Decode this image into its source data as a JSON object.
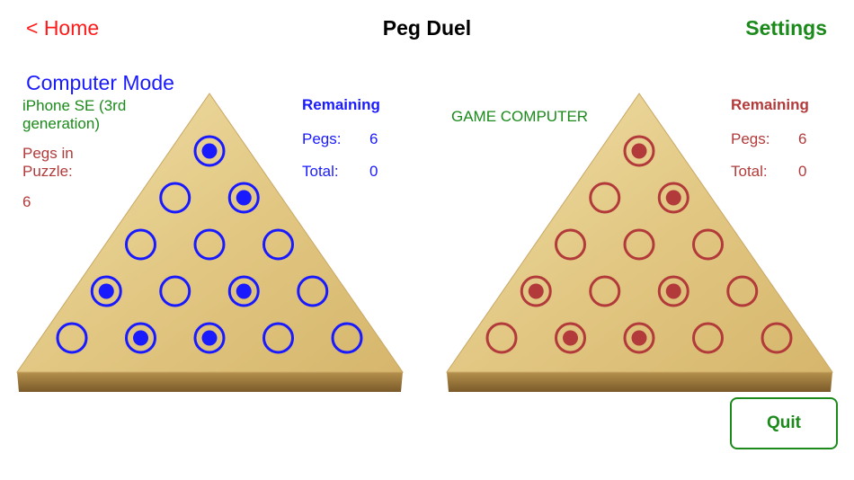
{
  "nav": {
    "back_label": "< Home",
    "title": "Peg Duel",
    "settings_label": "Settings"
  },
  "mode": "Computer Mode",
  "device": "iPhone SE (3rd generation)",
  "puzzle": {
    "pegs_in_label": "Pegs in Puzzle:",
    "pegs_in_value": "6"
  },
  "player": {
    "color": "#1a1aff",
    "remaining_title": "Remaining",
    "pegs_label": "Pegs:",
    "pegs_value": "6",
    "total_label": "Total:",
    "total_value": "0",
    "holes": [
      [
        1
      ],
      [
        0,
        1
      ],
      [
        0,
        0,
        0
      ],
      [
        1,
        0,
        1,
        0
      ],
      [
        0,
        1,
        1,
        0,
        0
      ]
    ]
  },
  "computer": {
    "color": "#b23a3a",
    "label": "GAME COMPUTER",
    "remaining_title": "Remaining",
    "pegs_label": "Pegs:",
    "pegs_value": "6",
    "total_label": "Total:",
    "total_value": "0",
    "holes": [
      [
        1
      ],
      [
        0,
        1
      ],
      [
        0,
        0,
        0
      ],
      [
        1,
        0,
        1,
        0
      ],
      [
        0,
        1,
        1,
        0,
        0
      ]
    ]
  },
  "quit_label": "Quit",
  "colors": {
    "wood_light": "#e8d49a",
    "wood_dark": "#b8914a",
    "green": "#1b8a1b",
    "home_red": "#ff1a1a"
  }
}
